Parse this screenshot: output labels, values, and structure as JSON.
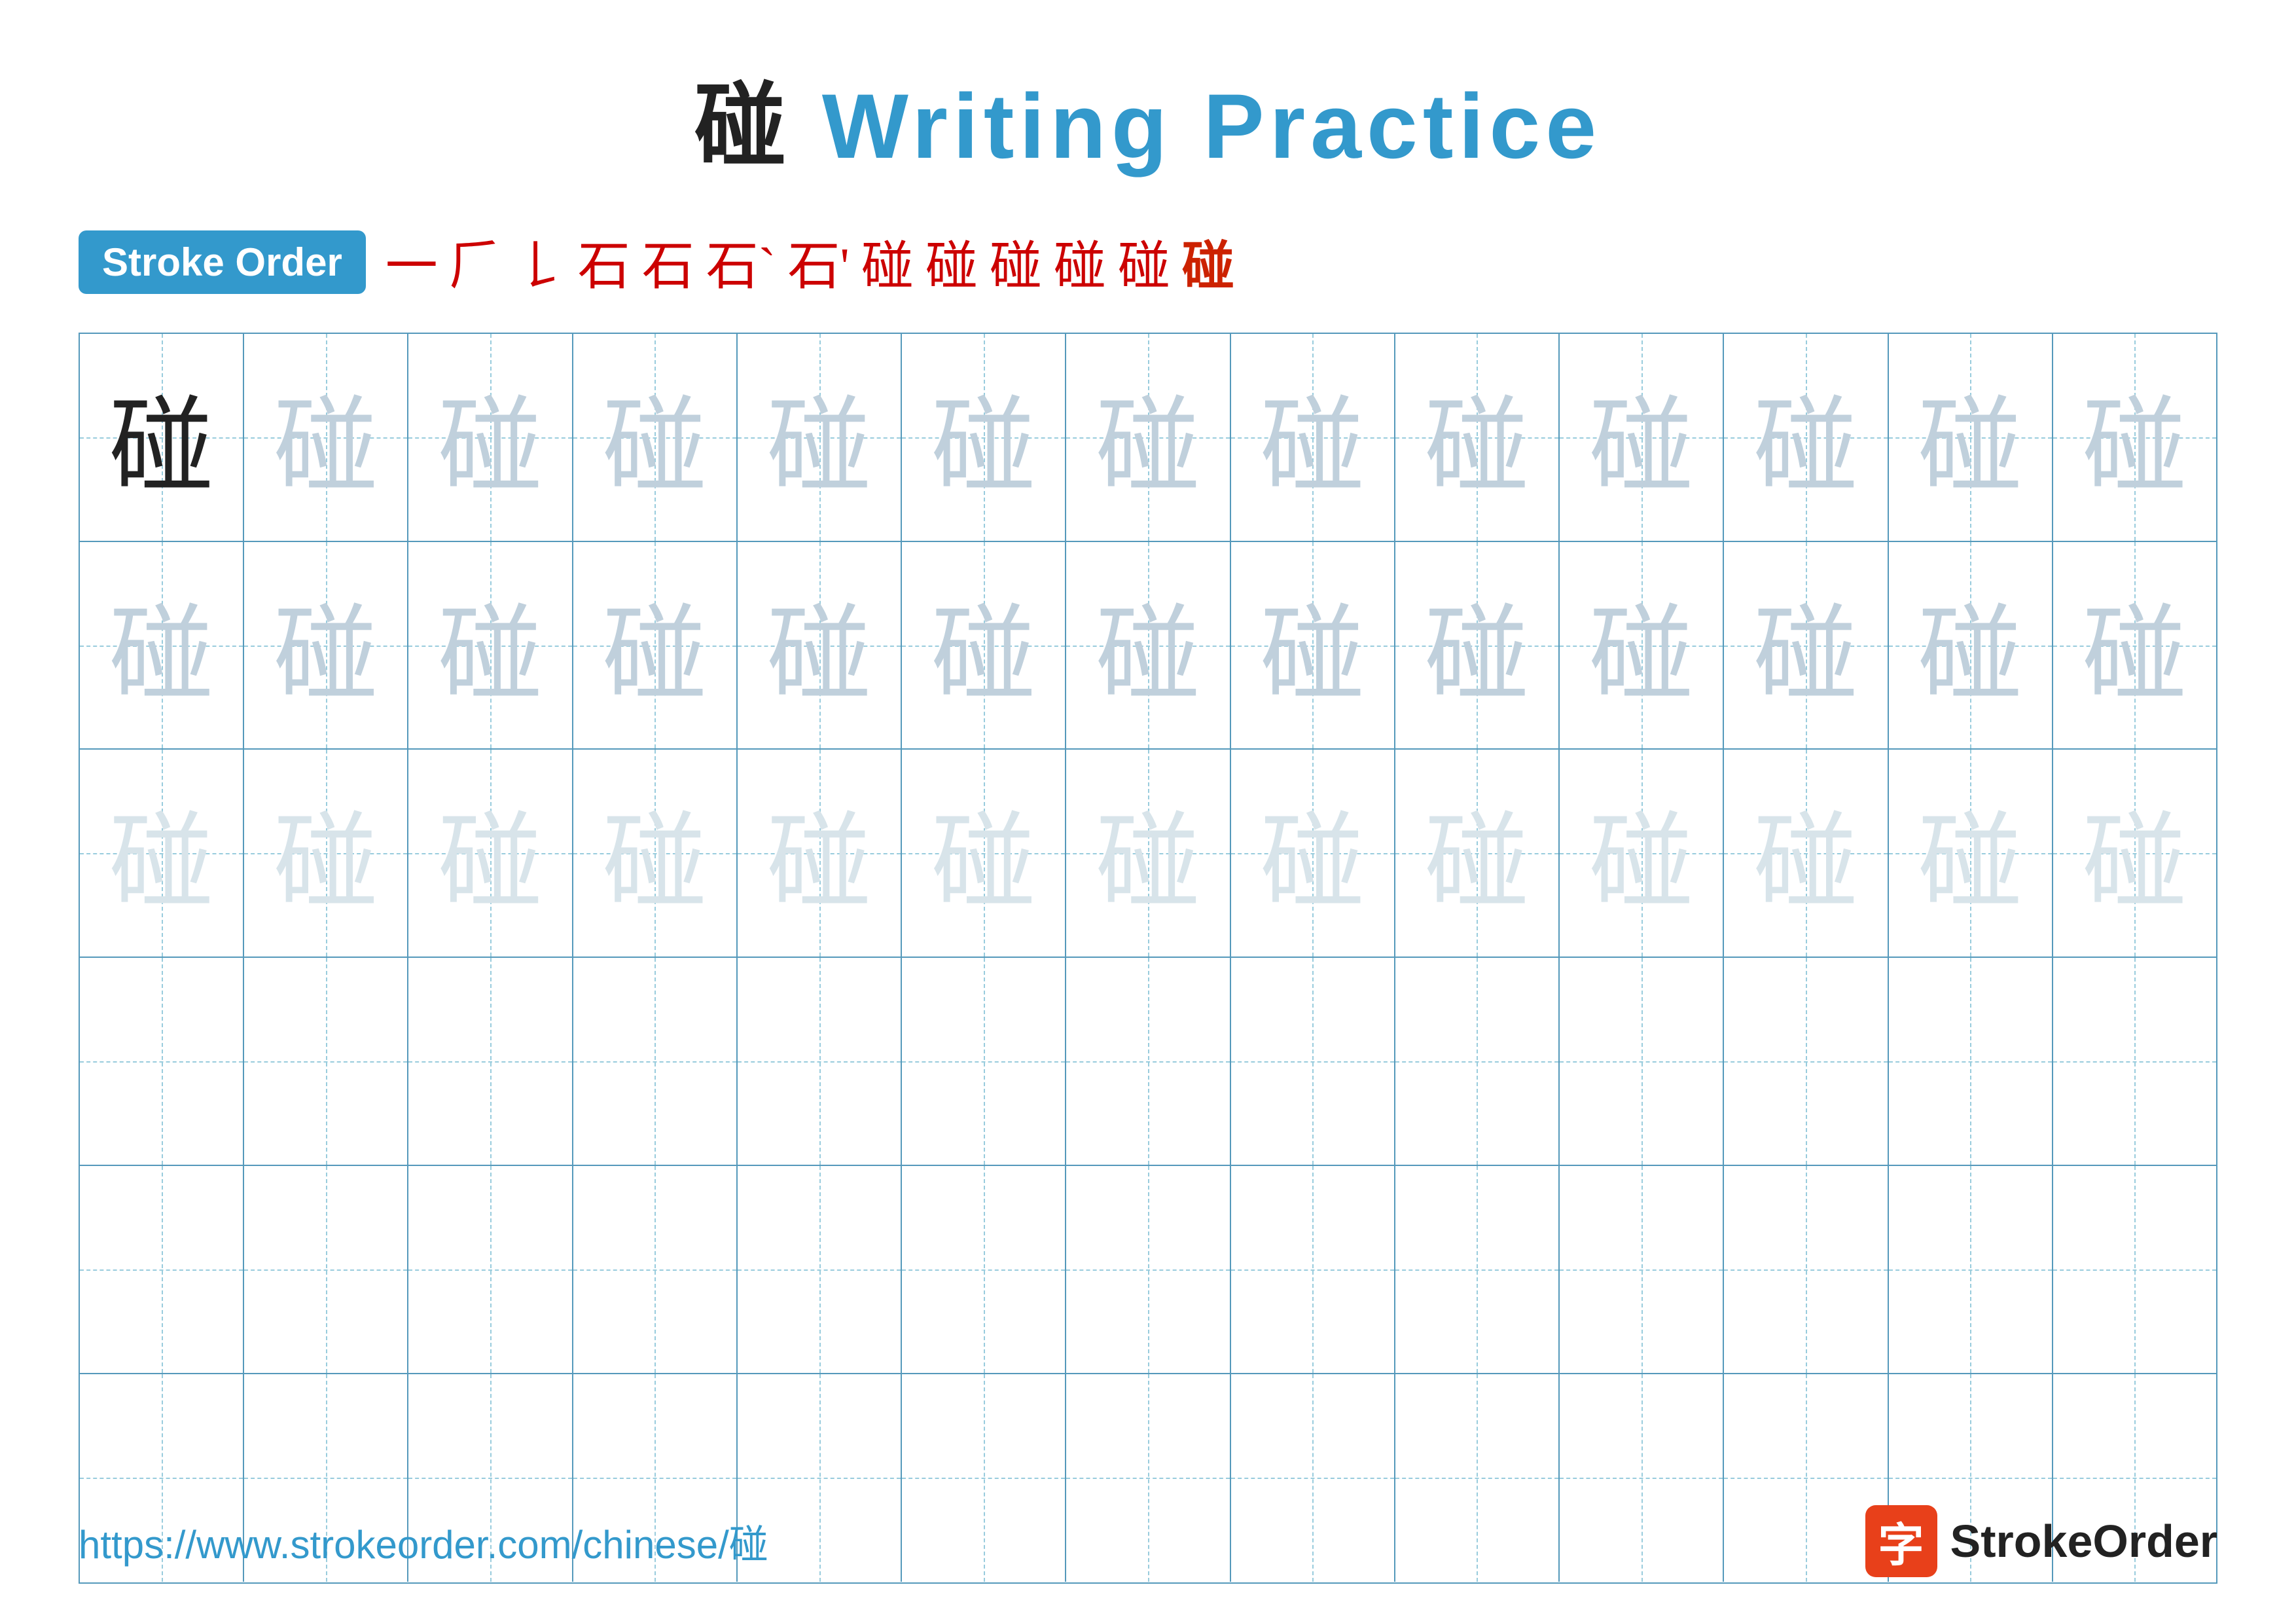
{
  "title": {
    "character": "碰",
    "text": " Writing Practice"
  },
  "stroke_order": {
    "badge_label": "Stroke Order",
    "strokes": [
      "一",
      "𠂆",
      "𠄌",
      "石",
      "石",
      "石`",
      "石'",
      "石𝌀",
      "碰⁻",
      "碰⁼",
      "碰⁺",
      "碰⁻",
      "碰"
    ]
  },
  "grid": {
    "rows": 6,
    "cols": 13,
    "main_char": "碰",
    "rows_data": [
      {
        "type": "dark_then_medium",
        "dark_count": 1
      },
      {
        "type": "medium"
      },
      {
        "type": "light"
      },
      {
        "type": "empty"
      },
      {
        "type": "empty"
      },
      {
        "type": "empty"
      }
    ]
  },
  "footer": {
    "url": "https://www.strokeorder.com/chinese/碰",
    "brand_name": "StrokeOrder",
    "logo_char": "字"
  }
}
